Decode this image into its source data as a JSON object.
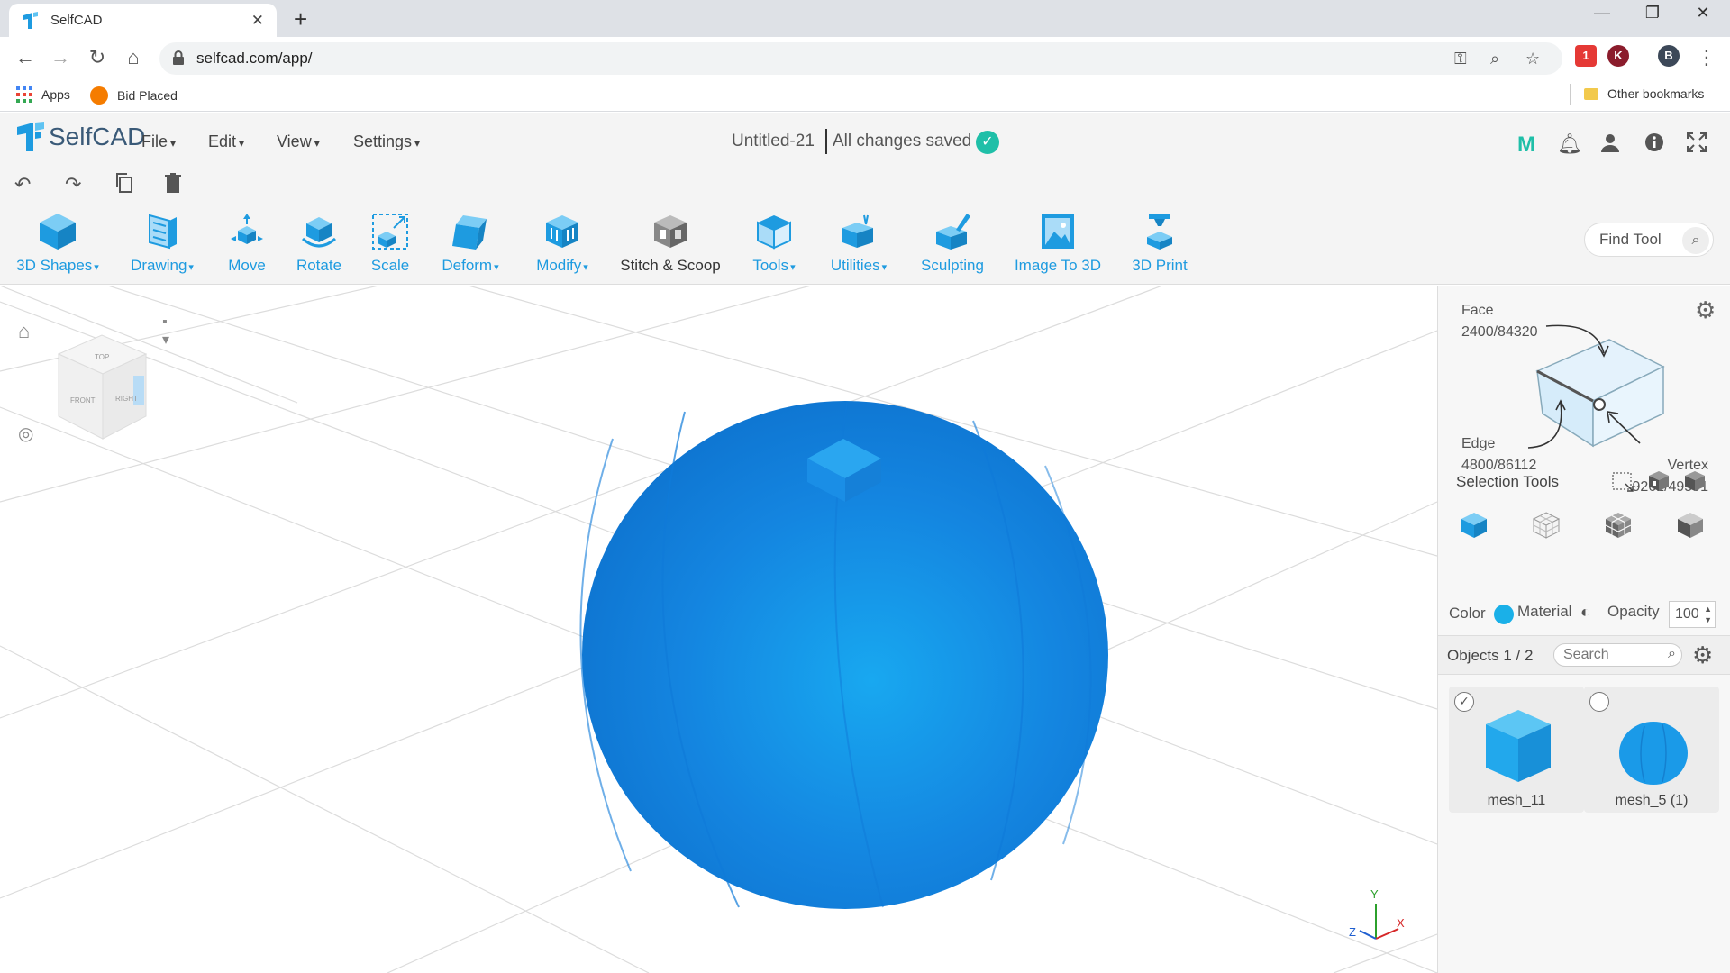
{
  "browser": {
    "tab_title": "SelfCAD",
    "tab_close": "✕",
    "new_tab": "+",
    "url": "selfcad.com/app/",
    "bookmarks": [
      {
        "label": "Apps",
        "icon": "apps-grid-icon"
      },
      {
        "label": "Bid Placed",
        "icon": "bid-placed-favicon"
      }
    ],
    "other_bookmarks": "Other bookmarks",
    "profile_initial": "B",
    "extension_initial": "K",
    "extension_badge": "1"
  },
  "app": {
    "logo_text": "SelfCAD",
    "menus": [
      "File",
      "Edit",
      "View",
      "Settings"
    ],
    "doc_title": "Untitled-21",
    "save_status": "All changes saved",
    "save_check": "✓"
  },
  "toolbar": {
    "tools": [
      {
        "label": "3D Shapes",
        "icon": "cube-icon",
        "dropdown": true
      },
      {
        "label": "Drawing",
        "icon": "drawing-icon",
        "dropdown": true
      },
      {
        "label": "Move",
        "icon": "move-icon",
        "dropdown": false
      },
      {
        "label": "Rotate",
        "icon": "rotate-icon",
        "dropdown": false
      },
      {
        "label": "Scale",
        "icon": "scale-icon",
        "dropdown": false
      },
      {
        "label": "Deform",
        "icon": "deform-icon",
        "dropdown": true
      },
      {
        "label": "Modify",
        "icon": "modify-icon",
        "dropdown": true
      },
      {
        "label": "Stitch & Scoop",
        "icon": "stitch-scoop-icon",
        "dropdown": false
      },
      {
        "label": "Tools",
        "icon": "tools-icon",
        "dropdown": true
      },
      {
        "label": "Utilities",
        "icon": "utilities-icon",
        "dropdown": true
      },
      {
        "label": "Sculpting",
        "icon": "sculpting-icon",
        "dropdown": false
      },
      {
        "label": "Image To 3D",
        "icon": "image-to-3d-icon",
        "dropdown": false
      },
      {
        "label": "3D Print",
        "icon": "3d-print-icon",
        "dropdown": false
      }
    ],
    "find_tool_placeholder": "Find Tool"
  },
  "viewport": {
    "viewcube_labels": {
      "top": "TOP",
      "front": "FRONT",
      "right": "RIGHT"
    },
    "axes": {
      "x": "X",
      "y": "Y",
      "z": "Z"
    },
    "object_color": "#1e90f0"
  },
  "panel": {
    "face_label": "Face",
    "face_value": "2400/84320",
    "edge_label": "Edge",
    "edge_value": "4800/86112",
    "vertex_label": "Vertex",
    "vertex_value": "9261/49591",
    "selection_tools_label": "Selection Tools",
    "color_label": "Color",
    "color_value": "#1ab0e8",
    "material_label": "Material",
    "opacity_label": "Opacity",
    "opacity_value": "100",
    "objects_label": "Objects 1 / 2",
    "search_placeholder": "Search",
    "objects": [
      {
        "name": "mesh_11",
        "checked": true
      },
      {
        "name": "mesh_5 (1)",
        "checked": false
      }
    ]
  }
}
